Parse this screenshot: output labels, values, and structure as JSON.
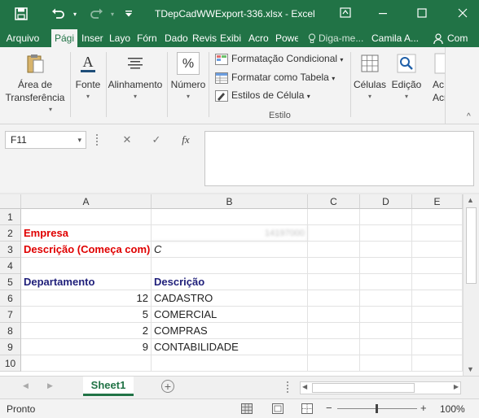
{
  "titlebar": {
    "title": "TDepCadWWExport-336.xlsx - Excel",
    "save_icon": "save-icon",
    "undo_icon": "undo-icon",
    "redo_icon": "redo-icon",
    "customize_icon": "chevron-down-icon",
    "ribbon_display_icon": "ribbon-display-icon",
    "minimize_icon": "minimize-icon",
    "maximize_icon": "maximize-icon",
    "close_icon": "close-icon"
  },
  "tabs": {
    "file": "Arquivo",
    "items": [
      "Pági",
      "Inser",
      "Layo",
      "Fórn",
      "Dado",
      "Revis",
      "Exibi",
      "Acro",
      "Powe"
    ],
    "tellme": "Diga-me...",
    "user": "Camila A...",
    "share": "Com"
  },
  "ribbon": {
    "clipboard": "Área de\nTransferência",
    "font": "Fonte",
    "alignment": "Alinhamento",
    "number": "Número",
    "conditional": "Formatação Condicional",
    "format_table": "Formatar como Tabela",
    "cell_styles": "Estilos de Célula",
    "styles_group": "Estilo",
    "cells": "Células",
    "editing": "Edição",
    "addins": "Ac",
    "addins2": "Acro",
    "number_symbol": "%"
  },
  "formula_bar": {
    "name_box": "F11",
    "cancel": "✕",
    "enter": "✓",
    "fx": "fx",
    "content": ""
  },
  "grid": {
    "columns": [
      "A",
      "B",
      "C",
      "D",
      "E"
    ],
    "rows": [
      "1",
      "2",
      "3",
      "4",
      "5",
      "6",
      "7",
      "8",
      "9",
      "10"
    ],
    "cells": {
      "A2": "Empresa",
      "B2": "14197000",
      "A3": "Descrição (Começa com)",
      "B3": "C",
      "A5": "Departamento",
      "B5": "Descrição",
      "A6": "12",
      "B6": "CADASTRO",
      "A7": "5",
      "B7": "COMERCIAL",
      "A8": "2",
      "B8": "COMPRAS",
      "A9": "9",
      "B9": "CONTABILIDADE"
    }
  },
  "sheets": {
    "active": "Sheet1",
    "add_icon": "plus-icon"
  },
  "status": {
    "ready": "Pronto",
    "zoom": "100%",
    "zoom_minus": "−",
    "zoom_plus": "+"
  },
  "colors": {
    "brand": "#217346",
    "header_red": "#e00000",
    "header_navy": "#1f1f7a"
  }
}
